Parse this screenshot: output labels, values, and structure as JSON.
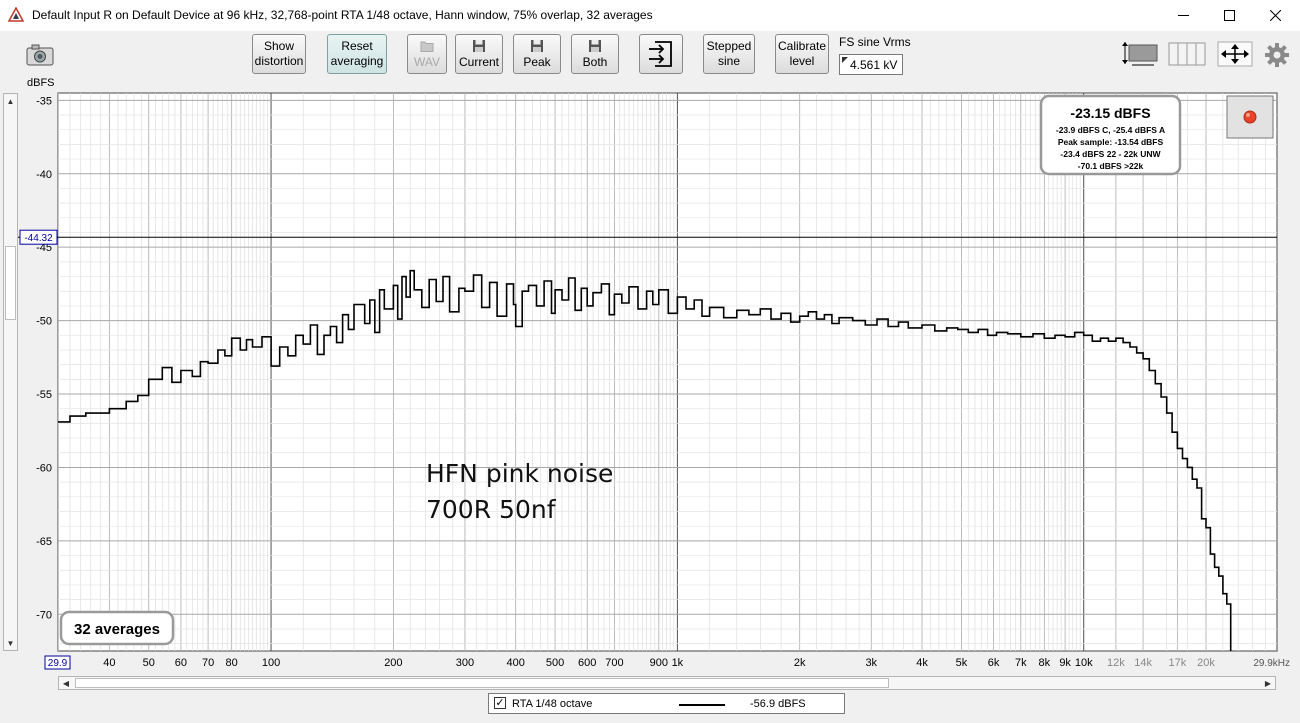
{
  "window": {
    "title": "Default Input R on Default Device at 96 kHz, 32,768-point RTA 1/48 octave, Hann window, 75% overlap, 32 averages",
    "minimize_icon": "minimize-icon",
    "maximize_icon": "maximize-icon",
    "close_icon": "close-icon"
  },
  "toolbar": {
    "camera_icon": "camera-icon",
    "show_distortion": [
      "Show",
      "distortion"
    ],
    "reset_averaging": [
      "Reset",
      "averaging"
    ],
    "wav": "WAV",
    "current": "Current",
    "peak": "Peak",
    "both": "Both",
    "save_icon": "floppy-disk-icon",
    "export_icon": "export-arrow-icon",
    "stepped_sine": [
      "Stepped",
      "sine"
    ],
    "calibrate_level": [
      "Calibrate",
      "level"
    ],
    "fs_sine_label": "FS sine Vrms",
    "fs_sine_value": "4.561 kV",
    "right_icons": [
      "graph-layout-icon",
      "panel-layout-icon",
      "move-arrows-icon",
      "gear-icon"
    ]
  },
  "level_panel": {
    "main": "-23.15 dBFS",
    "lines": [
      "-23.9 dBFS C, -25.4 dBFS A",
      "Peak sample: -13.54 dBFS",
      "-23.4 dBFS 22 - 22k UNW",
      "-70.1 dBFS >22k"
    ]
  },
  "record_icon": "record-indicator-icon",
  "averages_label": "32 averages",
  "annotation": [
    "HFN pink noise",
    "700R 50nf"
  ],
  "legend": {
    "checked_mark": "✓",
    "name": "RTA 1/48 octave",
    "value": "-56.9 dBFS",
    "color": "#000000"
  },
  "colors": {
    "plot_bg": "#ffffff",
    "trace": "#000000",
    "cursor_label": "#0000a0"
  },
  "chart_data": {
    "type": "line",
    "title": "",
    "xlabel": "",
    "ylabel": "dBFS",
    "x_scale": "log",
    "xlim": [
      29.9,
      29900
    ],
    "ylim": [
      -72.5,
      -34.5
    ],
    "y_ticks": [
      -35,
      -40,
      -45,
      -50,
      -55,
      -60,
      -65,
      -70
    ],
    "y_tick_labels": [
      "-35",
      "-40",
      "-45",
      "-50",
      "-55",
      "-60",
      "-65",
      "-70"
    ],
    "x_ticks": [
      40,
      50,
      60,
      70,
      80,
      100,
      200,
      300,
      400,
      500,
      600,
      700,
      900,
      1000,
      2000,
      3000,
      4000,
      5000,
      6000,
      7000,
      8000,
      9000,
      10000,
      12000,
      14000,
      17000,
      20000
    ],
    "x_tick_labels": [
      "40",
      "50",
      "60",
      "70",
      "80",
      "100",
      "200",
      "300",
      "400",
      "500",
      "600",
      "700",
      "900",
      "1k",
      "2k",
      "3k",
      "4k",
      "5k",
      "6k",
      "7k",
      "8k",
      "9k",
      "10k",
      "12k",
      "14k",
      "17k",
      "20k"
    ],
    "x_start_label": "29.9",
    "x_end_label": "29.9kHz",
    "cursor_level": -44.32,
    "cursor_label": "-44.32",
    "grid": true,
    "series": [
      {
        "name": "RTA 1/48 octave",
        "x": [
          29.9,
          32,
          35,
          40,
          44,
          47,
          50,
          54,
          57,
          60,
          64,
          67,
          70,
          74,
          77,
          80,
          84,
          87,
          90,
          95,
          100,
          105,
          110,
          115,
          120,
          125,
          130,
          135,
          140,
          145,
          150,
          155,
          160,
          170,
          175,
          180,
          185,
          190,
          200,
          205,
          210,
          215,
          220,
          225,
          235,
          245,
          255,
          265,
          275,
          290,
          300,
          315,
          330,
          345,
          360,
          380,
          395,
          400,
          415,
          430,
          450,
          470,
          490,
          500,
          520,
          540,
          560,
          580,
          600,
          620,
          650,
          680,
          700,
          730,
          760,
          800,
          840,
          870,
          900,
          950,
          1000,
          1050,
          1100,
          1150,
          1200,
          1300,
          1400,
          1500,
          1600,
          1700,
          1800,
          1900,
          2000,
          2100,
          2200,
          2300,
          2400,
          2500,
          2700,
          2900,
          3100,
          3300,
          3500,
          3700,
          4000,
          4300,
          4600,
          4900,
          5200,
          5500,
          5800,
          6100,
          6500,
          7000,
          7500,
          8000,
          8500,
          9000,
          9500,
          10000,
          10500,
          11000,
          11500,
          12000,
          12500,
          13000,
          13500,
          14000,
          14500,
          15000,
          15500,
          16000,
          16500,
          17000,
          17500,
          18000,
          18500,
          19000,
          19500,
          20000,
          20500,
          21000,
          21500,
          22000,
          22500,
          23000
        ],
        "y": [
          -56.9,
          -56.5,
          -56.3,
          -56.0,
          -55.5,
          -55.1,
          -54.0,
          -53.2,
          -54.2,
          -53.4,
          -53.8,
          -52.8,
          -52.9,
          -52.0,
          -52.4,
          -51.2,
          -52.0,
          -51.3,
          -51.8,
          -51.1,
          -53.1,
          -51.8,
          -52.4,
          -51.0,
          -51.6,
          -50.3,
          -52.3,
          -51.0,
          -50.4,
          -51.5,
          -49.6,
          -50.6,
          -48.9,
          -50.2,
          -48.6,
          -50.8,
          -47.9,
          -49.2,
          -47.6,
          -49.9,
          -47.0,
          -48.4,
          -46.6,
          -47.9,
          -49.1,
          -47.2,
          -48.7,
          -47.0,
          -49.4,
          -47.8,
          -48.0,
          -46.9,
          -49.1,
          -47.4,
          -49.7,
          -47.5,
          -48.9,
          -50.4,
          -48.0,
          -47.6,
          -49.0,
          -47.3,
          -49.5,
          -47.9,
          -48.6,
          -47.1,
          -49.3,
          -47.8,
          -49.0,
          -48.1,
          -47.5,
          -49.6,
          -48.2,
          -48.8,
          -47.7,
          -49.2,
          -48.0,
          -48.9,
          -47.9,
          -49.5,
          -48.4,
          -49.2,
          -48.6,
          -49.7,
          -49.1,
          -49.8,
          -49.3,
          -49.6,
          -49.2,
          -49.9,
          -49.5,
          -50.1,
          -49.7,
          -49.4,
          -49.9,
          -49.6,
          -50.2,
          -49.8,
          -50.0,
          -50.3,
          -49.9,
          -50.4,
          -50.1,
          -50.5,
          -50.3,
          -50.7,
          -50.5,
          -50.6,
          -50.8,
          -50.6,
          -51.0,
          -50.8,
          -50.9,
          -51.1,
          -50.9,
          -51.2,
          -51.0,
          -51.1,
          -50.8,
          -51.0,
          -51.4,
          -51.2,
          -51.4,
          -51.2,
          -51.5,
          -51.8,
          -52.2,
          -52.6,
          -53.4,
          -54.3,
          -55.2,
          -56.3,
          -57.6,
          -58.7,
          -59.4,
          -60.0,
          -60.8,
          -61.4,
          -63.5,
          -64.1,
          -65.9,
          -66.8,
          -67.4,
          -68.6,
          -69.3,
          -72.5
        ]
      }
    ]
  }
}
